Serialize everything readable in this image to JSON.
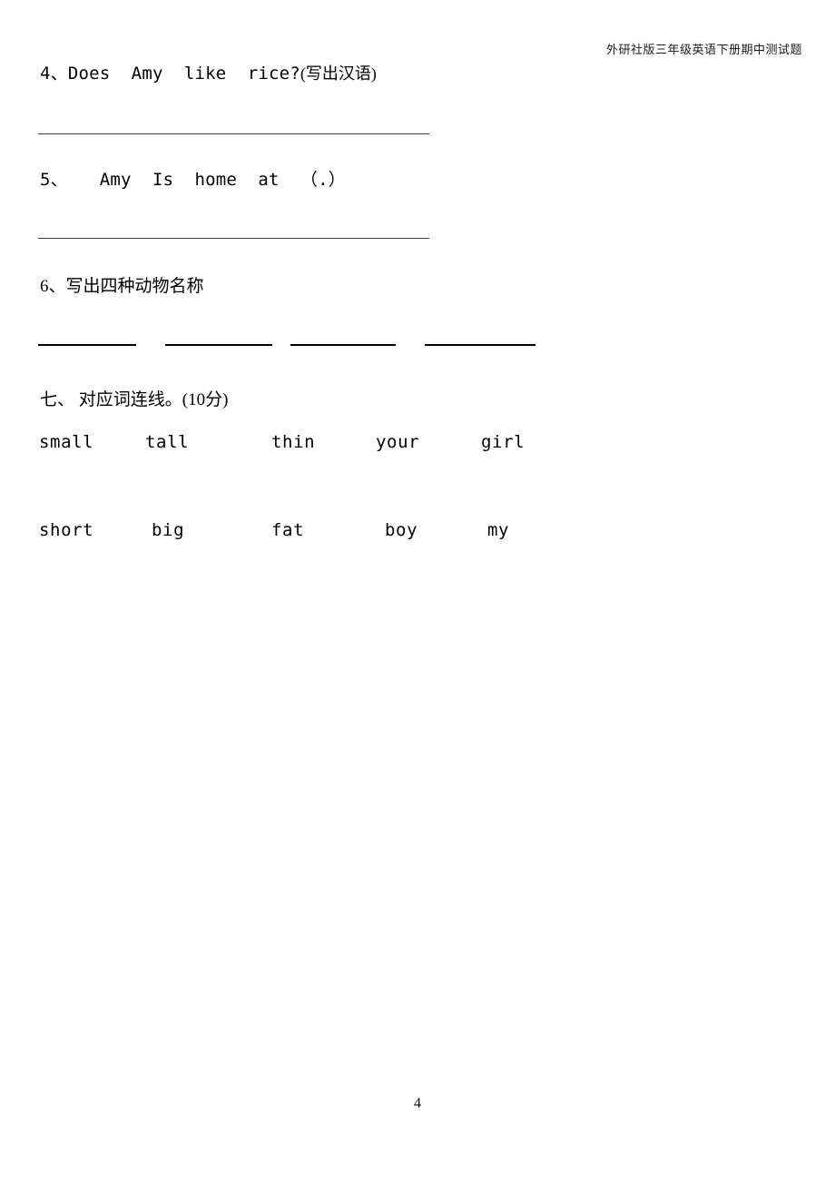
{
  "header": {
    "title": "外研社版三年级英语下册期中测试题"
  },
  "questions": [
    {
      "number": "4、",
      "english": "Does  Amy  like  rice?",
      "chinese_note": "(写出汉语)"
    },
    {
      "number": "5、",
      "english": "   Amy  Is  home  at  （.）",
      "chinese_note": ""
    },
    {
      "number": "6、",
      "english": "",
      "chinese_note": "写出四种动物名称"
    }
  ],
  "section": {
    "label": "七、",
    "title": " 对应词连线。(10分)"
  },
  "matching": {
    "row1": [
      "small",
      "tall",
      "thin",
      "your",
      "girl"
    ],
    "row2": [
      "short",
      "big",
      "fat",
      "boy",
      "my"
    ]
  },
  "footer": {
    "page_number": "4"
  }
}
